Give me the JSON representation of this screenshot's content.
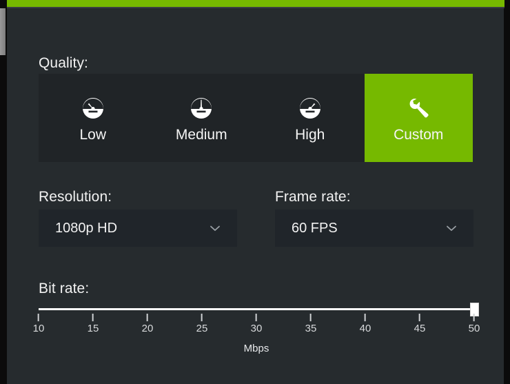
{
  "theme": {
    "accent_green": "#76b900",
    "panel_bg": "#262b2e",
    "group_bg": "#202427",
    "field_bg": "#20252a",
    "text": "#f2f2f2"
  },
  "quality": {
    "label": "Quality:",
    "selected": "Custom",
    "options": [
      {
        "label": "Low",
        "icon": "gauge-low-icon",
        "selected": false
      },
      {
        "label": "Medium",
        "icon": "gauge-medium-icon",
        "selected": false
      },
      {
        "label": "High",
        "icon": "gauge-high-icon",
        "selected": false
      },
      {
        "label": "Custom",
        "icon": "wrench-icon",
        "selected": true
      }
    ]
  },
  "resolution": {
    "label": "Resolution:",
    "value": "1080p HD",
    "chevron_icon": "chevron-down-icon"
  },
  "frame_rate": {
    "label": "Frame rate:",
    "value": "60 FPS",
    "chevron_icon": "chevron-down-icon"
  },
  "bit_rate": {
    "label": "Bit rate:",
    "units": "Mbps",
    "min": 10,
    "max": 50,
    "value": 50,
    "ticks": [
      {
        "value": 10,
        "label": "10"
      },
      {
        "value": 15,
        "label": "15"
      },
      {
        "value": 20,
        "label": "20"
      },
      {
        "value": 25,
        "label": "25"
      },
      {
        "value": 30,
        "label": "30"
      },
      {
        "value": 35,
        "label": "35"
      },
      {
        "value": 40,
        "label": "40"
      },
      {
        "value": 45,
        "label": "45"
      },
      {
        "value": 50,
        "label": "50"
      }
    ]
  }
}
